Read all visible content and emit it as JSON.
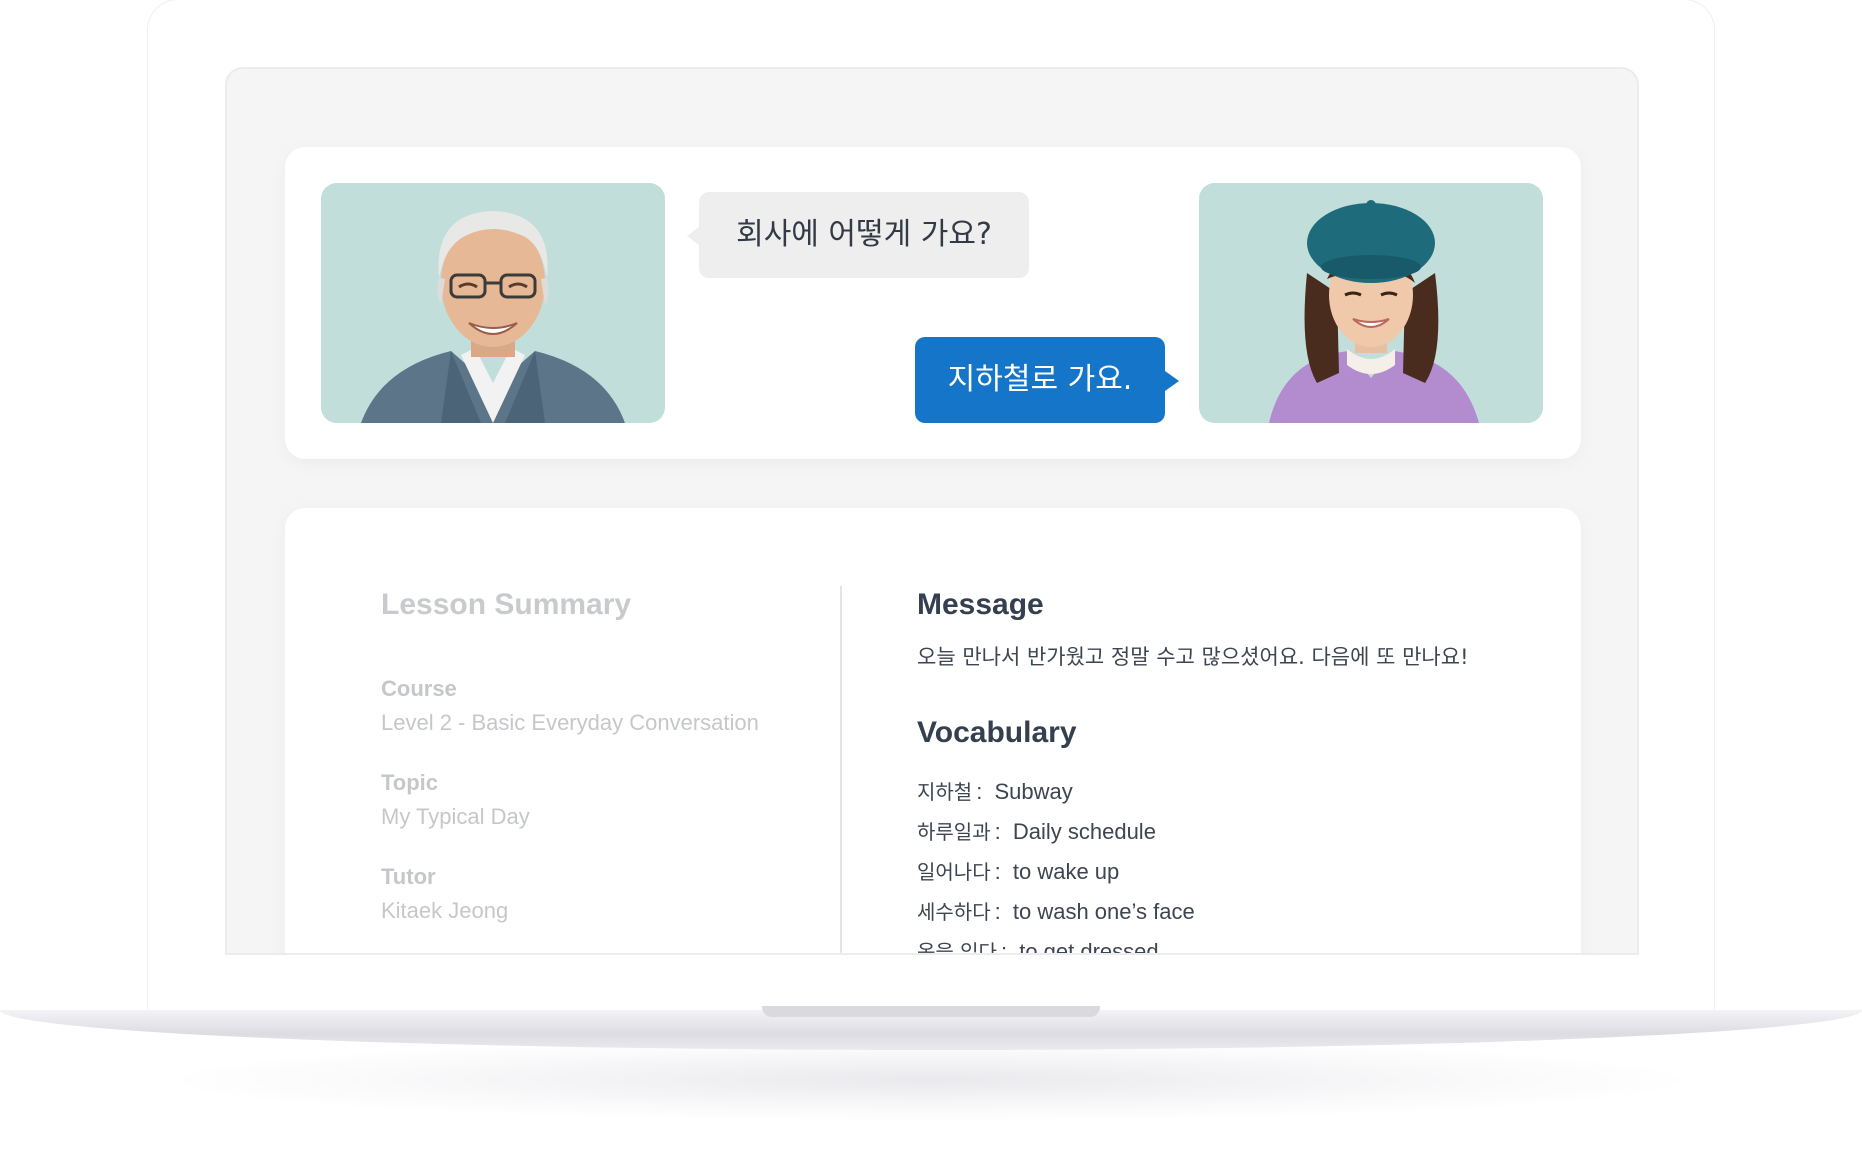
{
  "conversation": {
    "question_bubble": "회사에 어떻게 가요?",
    "answer_bubble": "지하철로 가요.",
    "tutor_photo_icon": "tutor-avatar",
    "student_photo_icon": "student-avatar"
  },
  "summary": {
    "title": "Lesson Summary",
    "course_label": "Course",
    "course_value": "Level 2 - Basic Everyday Conversation",
    "topic_label": "Topic",
    "topic_value": "My Typical Day",
    "tutor_label": "Tutor",
    "tutor_value": "Kitaek Jeong"
  },
  "message": {
    "title": "Message",
    "text": "오늘 만나서 반가웠고 정말 수고 많으셨어요. 다음에 또 만나요!"
  },
  "vocabulary": {
    "title": "Vocabulary",
    "items": [
      {
        "ko": "지하철",
        "en": "Subway"
      },
      {
        "ko": "하루일과",
        "en": "Daily schedule"
      },
      {
        "ko": "일어나다",
        "en": "to wake up"
      },
      {
        "ko": "세수하다",
        "en": "to wash one’s face"
      },
      {
        "ko": "옷을 입다",
        "en": "to get dressed"
      }
    ]
  },
  "colors": {
    "accent_blue": "#1575c8",
    "photo_bg": "#c1dedb"
  }
}
